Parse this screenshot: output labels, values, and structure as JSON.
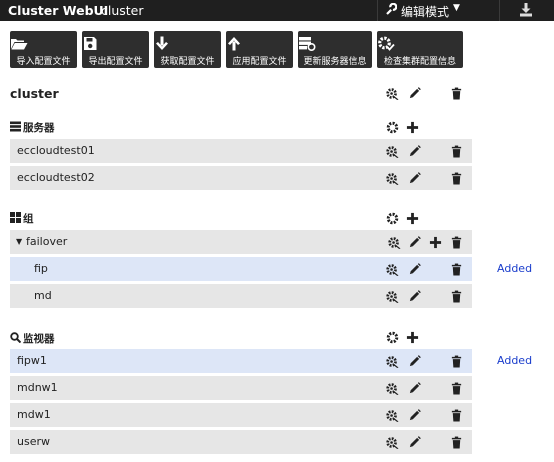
{
  "header": {
    "app_title": "Cluster WebUI",
    "cluster_name": "cluster",
    "mode_label": "编辑模式"
  },
  "toolbar": {
    "import": "导入配置文件",
    "export": "导出配置文件",
    "get": "获取配置文件",
    "apply": "应用配置文件",
    "update_server": "更新服务器信息",
    "check": "检查集群配置信息"
  },
  "tree": {
    "cluster_title": "cluster",
    "servers": {
      "title": "服务器",
      "items": [
        "eccloudtest01",
        "eccloudtest02"
      ]
    },
    "groups": {
      "title": "组",
      "group_name": "failover",
      "resources": [
        {
          "name": "fip",
          "status": "Added"
        },
        {
          "name": "md"
        }
      ]
    },
    "monitors": {
      "title": "监视器",
      "items": [
        {
          "name": "fipw1",
          "status": "Added"
        },
        {
          "name": "mdnw1"
        },
        {
          "name": "mdw1"
        },
        {
          "name": "userw"
        }
      ]
    }
  },
  "colors": {
    "topbar": "#1f1f1f",
    "button": "#2e2e2e",
    "row": "#e6e6e6",
    "row_highlight": "#dde6f7",
    "added": "#1a3dcc"
  }
}
